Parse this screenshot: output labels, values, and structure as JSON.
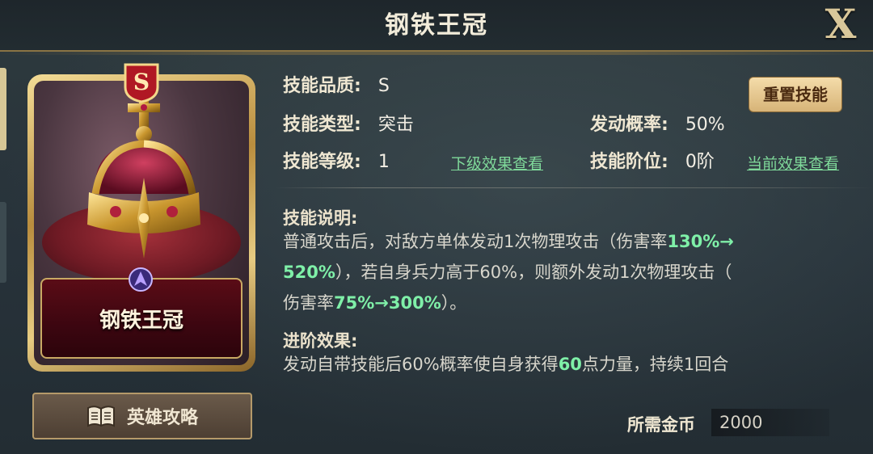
{
  "header": {
    "title": "钢铁王冠",
    "close_label": "X"
  },
  "card": {
    "name": "钢铁王冠",
    "grade": "S"
  },
  "guide_button": {
    "label": "英雄攻略"
  },
  "skill": {
    "quality_label": "技能品质:",
    "quality_value": "S",
    "type_label": "技能类型:",
    "type_value": "突击",
    "level_label": "技能等级:",
    "level_value": "1",
    "next_level_link": "下级效果查看",
    "trigger_label": "发动概率:",
    "trigger_value": "50%",
    "rank_label": "技能阶位:",
    "rank_value": "0阶",
    "current_effect_link": "当前效果查看",
    "reset_button": "重置技能"
  },
  "description": {
    "title": "技能说明:",
    "line1_a": "普通攻击后，对敌方单体发动1次物理攻击（伤害率",
    "line1_hl": "130%→",
    "line2_hl": "520%",
    "line2_b": "），若自身兵力高于60%，则额外发动1次物理攻击（",
    "line3_a": "伤害率",
    "line3_hl": "75%→300%",
    "line3_b": "）。"
  },
  "advance": {
    "title": "进阶效果:",
    "text_a": "发动自带技能后60%概率使自身获得",
    "text_hl": "60",
    "text_b": "点力量，持续1回合"
  },
  "cost": {
    "label": "所需金币",
    "value": "2000"
  },
  "colors": {
    "highlight": "#7ff0a8",
    "gold": "#c9a964",
    "link": "#7fd99a"
  }
}
